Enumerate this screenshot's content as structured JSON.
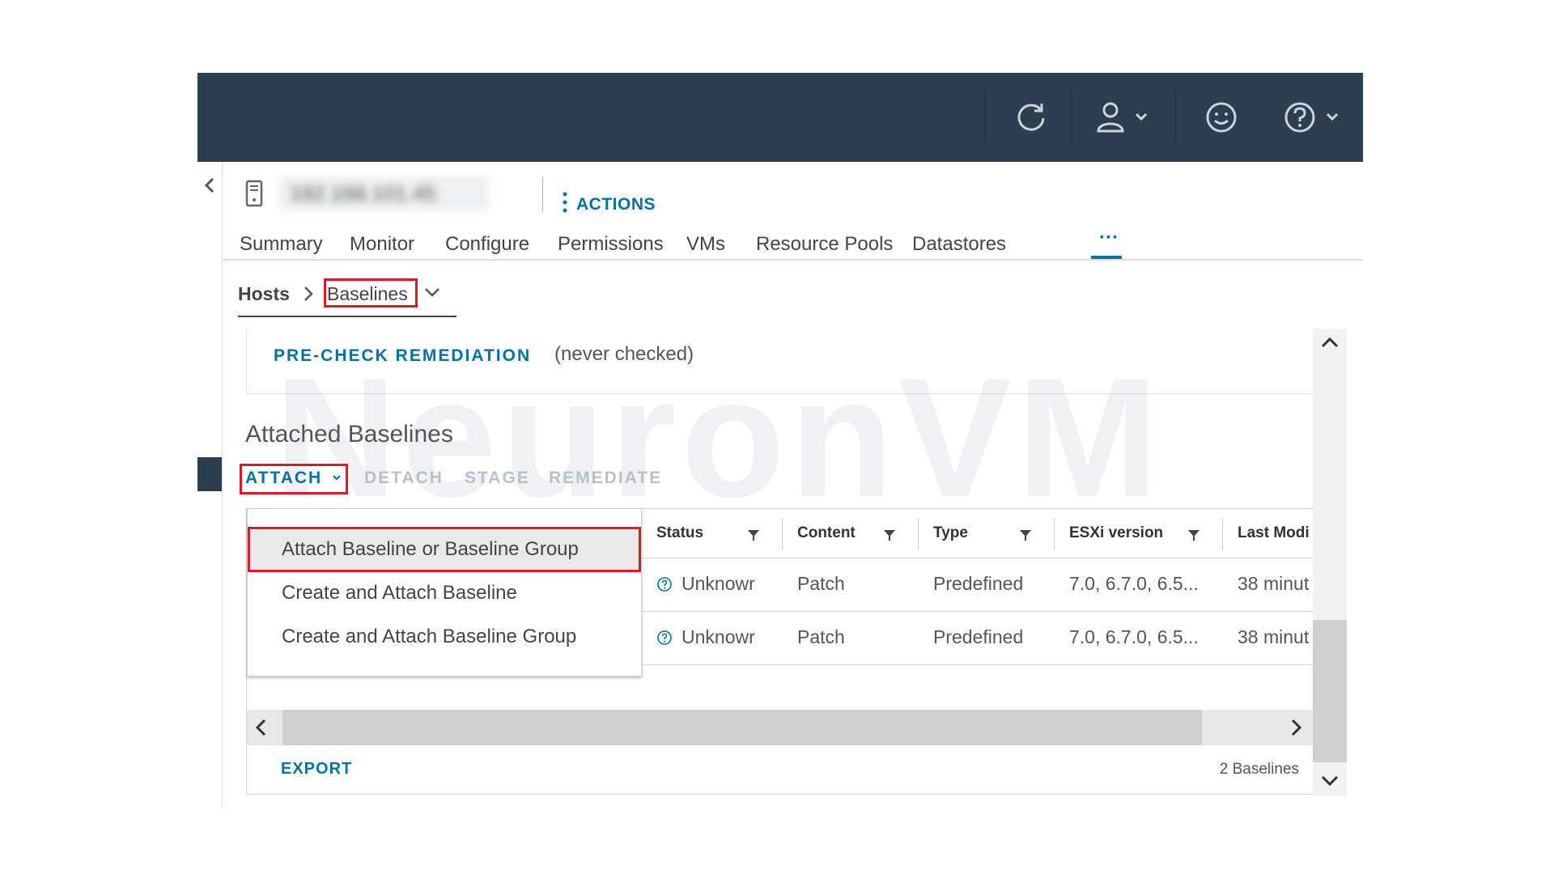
{
  "object": {
    "name": "192.168.101.45"
  },
  "header": {
    "actions_label": "ACTIONS"
  },
  "tabs": [
    {
      "label": "Summary"
    },
    {
      "label": "Monitor"
    },
    {
      "label": "Configure"
    },
    {
      "label": "Permissions"
    },
    {
      "label": "VMs"
    },
    {
      "label": "Resource Pools"
    },
    {
      "label": "Datastores"
    },
    {
      "label": "···"
    }
  ],
  "breadcrumb": {
    "parent": "Hosts",
    "current": "Baselines"
  },
  "precheck": {
    "action_label": "PRE-CHECK REMEDIATION",
    "status": "(never checked)"
  },
  "attached": {
    "title": "Attached Baselines",
    "toolbar": {
      "attach": "ATTACH",
      "detach": "DETACH",
      "stage": "STAGE",
      "remediate": "REMEDIATE"
    },
    "attach_menu": [
      "Attach Baseline or Baseline Group",
      "Create and Attach Baseline",
      "Create and Attach Baseline Group"
    ],
    "columns": [
      "Status",
      "Content",
      "Type",
      "ESXi version",
      "Last Modi"
    ],
    "rows": [
      {
        "status": "Unknowr",
        "content": "Patch",
        "type": "Predefined",
        "esxi": "7.0, 6.7.0, 6.5...",
        "modified": "38 minut"
      },
      {
        "status": "Unknowr",
        "content": "Patch",
        "type": "Predefined",
        "esxi": "7.0, 6.7.0, 6.5...",
        "modified": "38 minut"
      }
    ],
    "export_label": "EXPORT",
    "count_text": "2 Baselines"
  },
  "watermark": "NeuronVM",
  "colors": {
    "topbar": "#2d3e4e",
    "link": "#0072a3",
    "highlight": "#d21e2b"
  }
}
